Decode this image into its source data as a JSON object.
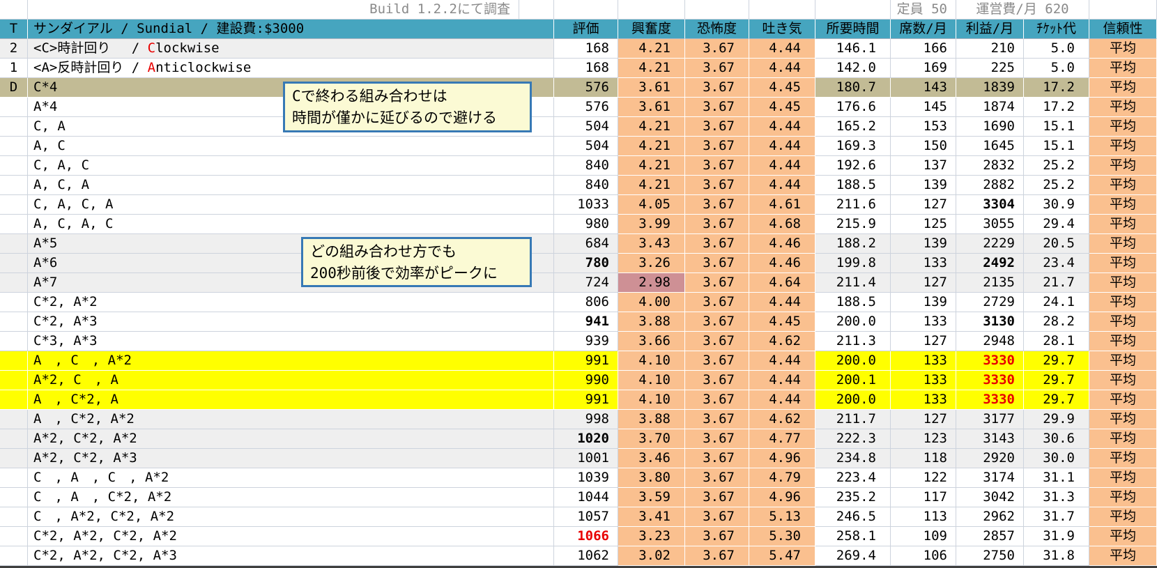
{
  "meta": {
    "build_note": "Build 1.2.2にて調査",
    "capacity_label": "定員 50",
    "operating_cost_label": "運営費/月 620"
  },
  "header": {
    "t": "T",
    "name": "サンダイアル / Sundial / 建設費:$3000",
    "cols": [
      "評価",
      "興奮度",
      "恐怖度",
      "吐き気",
      "所要時間",
      "席数/月",
      "利益/月",
      "ﾁｹｯﾄ代",
      "信頼性"
    ]
  },
  "colors": {
    "header_teal": "#46a5bf",
    "stat_orange": "#fac08f",
    "highlight_yellow": "#ffff00",
    "selected_khaki": "#c2bb95",
    "low_excitement_pink": "#ce9095",
    "band_gray": "#efefef",
    "warning_red": "#e80000",
    "callout_bg": "#fbfad4",
    "callout_border": "#3779b5"
  },
  "callouts": [
    {
      "lines": [
        "Cで終わる組み合わせは",
        "時間が僅かに延びるので避ける"
      ]
    },
    {
      "lines": [
        "どの組み合わせ方でも",
        "200秒前後で効率がピークに"
      ]
    }
  ],
  "rows": [
    {
      "t": "2",
      "name_pre": "<C>時計回り　 / ",
      "name_red": "C",
      "name_post": "lockwise",
      "rating": "168",
      "excitement": "4.21",
      "fear": "3.67",
      "nausea": "4.44",
      "time": "146.1",
      "seats": "166",
      "profit": "210",
      "ticket": "5.0",
      "reliability": "平均",
      "bg": "band2"
    },
    {
      "t": "1",
      "name_pre": "<A>反時計回り / ",
      "name_red": "A",
      "name_post": "nticlockwise",
      "rating": "168",
      "excitement": "4.21",
      "fear": "3.67",
      "nausea": "4.44",
      "time": "142.0",
      "seats": "169",
      "profit": "225",
      "ticket": "5.0",
      "reliability": "平均",
      "bg": ""
    },
    {
      "t": "D",
      "name_pre": "C*4",
      "rating": "576",
      "excitement": "3.61",
      "fear": "3.67",
      "nausea": "4.45",
      "time": "180.7",
      "seats": "143",
      "profit": "1839",
      "ticket": "17.2",
      "reliability": "平均",
      "bg": "khaki"
    },
    {
      "t": "",
      "name_pre": "A*4",
      "rating": "576",
      "excitement": "3.61",
      "fear": "3.67",
      "nausea": "4.45",
      "time": "176.6",
      "seats": "145",
      "profit": "1874",
      "ticket": "17.2",
      "reliability": "平均",
      "bg": ""
    },
    {
      "t": "",
      "name_pre": "C, A",
      "rating": "504",
      "excitement": "4.21",
      "fear": "3.67",
      "nausea": "4.44",
      "time": "165.2",
      "seats": "153",
      "profit": "1690",
      "ticket": "15.1",
      "reliability": "平均",
      "bg": ""
    },
    {
      "t": "",
      "name_pre": "A, C",
      "rating": "504",
      "excitement": "4.21",
      "fear": "3.67",
      "nausea": "4.44",
      "time": "169.3",
      "seats": "150",
      "profit": "1645",
      "ticket": "15.1",
      "reliability": "平均",
      "bg": ""
    },
    {
      "t": "",
      "name_pre": "C, A, C",
      "rating": "840",
      "excitement": "4.21",
      "fear": "3.67",
      "nausea": "4.44",
      "time": "192.6",
      "seats": "137",
      "profit": "2832",
      "ticket": "25.2",
      "reliability": "平均",
      "bg": ""
    },
    {
      "t": "",
      "name_pre": "A, C, A",
      "rating": "840",
      "excitement": "4.21",
      "fear": "3.67",
      "nausea": "4.44",
      "time": "188.5",
      "seats": "139",
      "profit": "2882",
      "ticket": "25.2",
      "reliability": "平均",
      "bg": ""
    },
    {
      "t": "",
      "name_pre": "C, A, C, A",
      "rating": "1033",
      "excitement": "4.05",
      "fear": "3.67",
      "nausea": "4.61",
      "time": "211.6",
      "seats": "127",
      "profit": "3304",
      "ticket": "30.9",
      "reliability": "平均",
      "bg": "",
      "profit_bold": true
    },
    {
      "t": "",
      "name_pre": "A, C, A, C",
      "rating": "980",
      "excitement": "3.99",
      "fear": "3.67",
      "nausea": "4.68",
      "time": "215.9",
      "seats": "125",
      "profit": "3055",
      "ticket": "29.4",
      "reliability": "平均",
      "bg": ""
    },
    {
      "t": "",
      "name_pre": "A*5",
      "rating": "684",
      "excitement": "3.43",
      "fear": "3.67",
      "nausea": "4.46",
      "time": "188.2",
      "seats": "139",
      "profit": "2229",
      "ticket": "20.5",
      "reliability": "平均",
      "bg": "band"
    },
    {
      "t": "",
      "name_pre": "A*6",
      "rating": "780",
      "excitement": "3.26",
      "fear": "3.67",
      "nausea": "4.46",
      "time": "199.8",
      "seats": "133",
      "profit": "2492",
      "ticket": "23.4",
      "reliability": "平均",
      "bg": "band",
      "rating_bold": true,
      "profit_bold": true
    },
    {
      "t": "",
      "name_pre": "A*7",
      "rating": "724",
      "excitement": "2.98",
      "fear": "3.67",
      "nausea": "4.64",
      "time": "211.4",
      "seats": "127",
      "profit": "2135",
      "ticket": "21.7",
      "reliability": "平均",
      "bg": "band",
      "excitement_pink": true
    },
    {
      "t": "",
      "name_pre": "C*2, A*2",
      "rating": "806",
      "excitement": "4.00",
      "fear": "3.67",
      "nausea": "4.44",
      "time": "188.5",
      "seats": "139",
      "profit": "2729",
      "ticket": "24.1",
      "reliability": "平均",
      "bg": ""
    },
    {
      "t": "",
      "name_pre": "C*2, A*3",
      "rating": "941",
      "excitement": "3.88",
      "fear": "3.67",
      "nausea": "4.45",
      "time": "200.0",
      "seats": "133",
      "profit": "3130",
      "ticket": "28.2",
      "reliability": "平均",
      "bg": "",
      "rating_bold": true,
      "profit_bold": true
    },
    {
      "t": "",
      "name_pre": "C*3, A*3",
      "rating": "939",
      "excitement": "3.66",
      "fear": "3.67",
      "nausea": "4.62",
      "time": "211.3",
      "seats": "127",
      "profit": "2948",
      "ticket": "28.1",
      "reliability": "平均",
      "bg": ""
    },
    {
      "t": "",
      "name_pre": "A　, C　, A*2",
      "rating": "991",
      "excitement": "4.10",
      "fear": "3.67",
      "nausea": "4.44",
      "time": "200.0",
      "seats": "133",
      "profit": "3330",
      "ticket": "29.7",
      "reliability": "平均",
      "bg": "yellow",
      "profit_bold": true,
      "profit_red": true
    },
    {
      "t": "",
      "name_pre": "A*2, C　, A",
      "rating": "990",
      "excitement": "4.10",
      "fear": "3.67",
      "nausea": "4.44",
      "time": "200.1",
      "seats": "133",
      "profit": "3330",
      "ticket": "29.7",
      "reliability": "平均",
      "bg": "yellow",
      "profit_bold": true,
      "profit_red": true
    },
    {
      "t": "",
      "name_pre": "A　, C*2, A",
      "rating": "991",
      "excitement": "4.10",
      "fear": "3.67",
      "nausea": "4.44",
      "time": "200.0",
      "seats": "133",
      "profit": "3330",
      "ticket": "29.7",
      "reliability": "平均",
      "bg": "yellow",
      "profit_bold": true,
      "profit_red": true
    },
    {
      "t": "",
      "name_pre": "A　, C*2, A*2",
      "rating": "998",
      "excitement": "3.88",
      "fear": "3.67",
      "nausea": "4.62",
      "time": "211.7",
      "seats": "127",
      "profit": "3177",
      "ticket": "29.9",
      "reliability": "平均",
      "bg": "band"
    },
    {
      "t": "",
      "name_pre": "A*2, C*2, A*2",
      "rating": "1020",
      "excitement": "3.70",
      "fear": "3.67",
      "nausea": "4.77",
      "time": "222.3",
      "seats": "123",
      "profit": "3143",
      "ticket": "30.6",
      "reliability": "平均",
      "bg": "band",
      "rating_bold": true
    },
    {
      "t": "",
      "name_pre": "A*2, C*2, A*3",
      "rating": "1001",
      "excitement": "3.46",
      "fear": "3.67",
      "nausea": "4.96",
      "time": "234.8",
      "seats": "118",
      "profit": "2920",
      "ticket": "30.0",
      "reliability": "平均",
      "bg": "band"
    },
    {
      "t": "",
      "name_pre": "C　, A　, C　, A*2",
      "rating": "1039",
      "excitement": "3.80",
      "fear": "3.67",
      "nausea": "4.79",
      "time": "223.4",
      "seats": "122",
      "profit": "3174",
      "ticket": "31.1",
      "reliability": "平均",
      "bg": ""
    },
    {
      "t": "",
      "name_pre": "C　, A　, C*2, A*2",
      "rating": "1044",
      "excitement": "3.59",
      "fear": "3.67",
      "nausea": "4.96",
      "time": "235.2",
      "seats": "117",
      "profit": "3042",
      "ticket": "31.3",
      "reliability": "平均",
      "bg": ""
    },
    {
      "t": "",
      "name_pre": "C　, A*2, C*2, A*2",
      "rating": "1057",
      "excitement": "3.41",
      "fear": "3.67",
      "nausea": "5.13",
      "time": "246.5",
      "seats": "113",
      "profit": "2962",
      "ticket": "31.7",
      "reliability": "平均",
      "bg": ""
    },
    {
      "t": "",
      "name_pre": "C*2, A*2, C*2, A*2",
      "rating": "1066",
      "excitement": "3.23",
      "fear": "3.67",
      "nausea": "5.30",
      "time": "258.1",
      "seats": "109",
      "profit": "2857",
      "ticket": "31.9",
      "reliability": "平均",
      "bg": "",
      "rating_bold": true,
      "rating_red": true
    },
    {
      "t": "",
      "name_pre": "C*2, A*2, C*2, A*3",
      "rating": "1062",
      "excitement": "3.02",
      "fear": "3.67",
      "nausea": "5.47",
      "time": "269.4",
      "seats": "106",
      "profit": "2750",
      "ticket": "31.8",
      "reliability": "平均",
      "bg": ""
    }
  ]
}
